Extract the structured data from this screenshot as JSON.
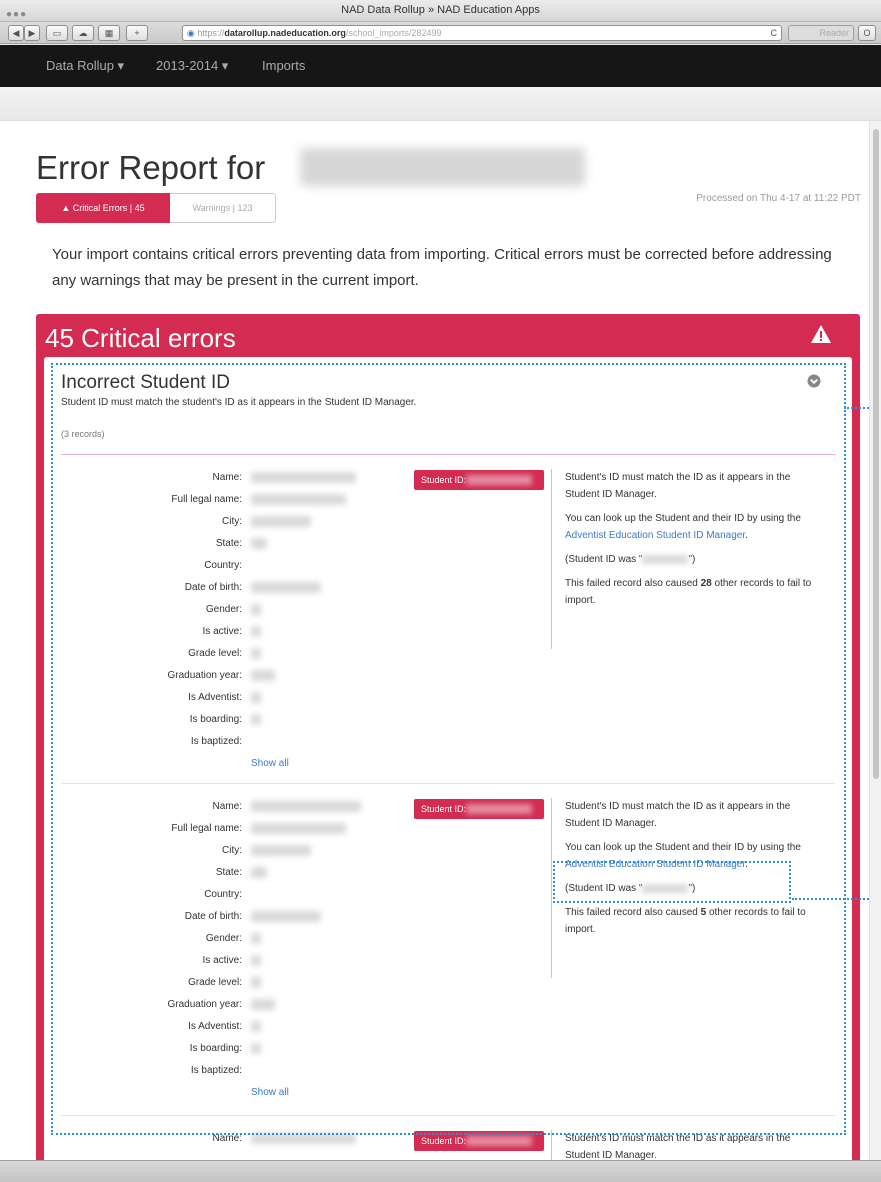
{
  "window": {
    "title": "NAD Data Rollup » NAD Education Apps"
  },
  "toolbar": {
    "back_label": "◀",
    "forward_label": "▶",
    "url_prefix": "https://",
    "url_host": "datarollup.nadeducation.org",
    "url_path": "/school_imports/282499",
    "reload_label": "C",
    "reader_label": "Reader"
  },
  "nav": {
    "brand": "Data Rollup ▾",
    "year": "2013-2014 ▾",
    "imports": "Imports"
  },
  "page": {
    "title": "Error Report for",
    "critical_tab": "▲ Critical Errors | 45",
    "warnings_tab": "Warnings | 123",
    "processed": "Processed on Thu 4-17 at 11:22 PDT",
    "intro": "Your import contains critical errors preventing data from importing. Critical errors must be corrected before addressing any warnings that may be present in the current import."
  },
  "panel": {
    "title": "45 Critical errors",
    "error_title": "Incorrect Student ID",
    "error_desc": "Student ID must match the student's ID as it appears in the Student ID Manager.",
    "record_count": "(3 records)"
  },
  "labels": {
    "name": "Name:",
    "full_legal_name": "Full legal name:",
    "city": "City:",
    "state": "State:",
    "country": "Country:",
    "dob": "Date of birth:",
    "gender": "Gender:",
    "is_active": "Is active:",
    "grade_level": "Grade level:",
    "graduation_year": "Graduation year:",
    "is_adventist": "Is Adventist:",
    "is_boarding": "Is boarding:",
    "is_baptized": "Is baptized:",
    "show_all": "Show all",
    "student_id_badge": "Student ID:"
  },
  "records": [
    {
      "msg1": "Student's ID must match the ID as it appears in the Student ID Manager.",
      "msg2_pre": "You can look up the Student and their ID by using the ",
      "link": "Adventist Education Student ID Manager",
      "msg2_post": ".",
      "was_pre": "(Student ID was \"",
      "was_post": "\")",
      "caused_pre": "This failed record also caused ",
      "caused_count": "28",
      "caused_post": " other records to fail to import."
    },
    {
      "msg1": "Student's ID must match the ID as it appears in the Student ID Manager.",
      "msg2_pre": "You can look up the Student and their ID by using the ",
      "link": "Adventist Education Student ID Manager",
      "msg2_post": ".",
      "was_pre": "(Student ID was \"",
      "was_post": "\")",
      "caused_pre": "This failed record also caused ",
      "caused_count": "5",
      "caused_post": " other records to fail to import."
    },
    {
      "msg1": "Student's ID must match the ID as it appears in the Student ID Manager."
    }
  ],
  "colors": {
    "accent": "#d32b52",
    "link": "#3a7bc8",
    "nav_bg": "#161616",
    "focus_ring": "#2a8ed8"
  }
}
